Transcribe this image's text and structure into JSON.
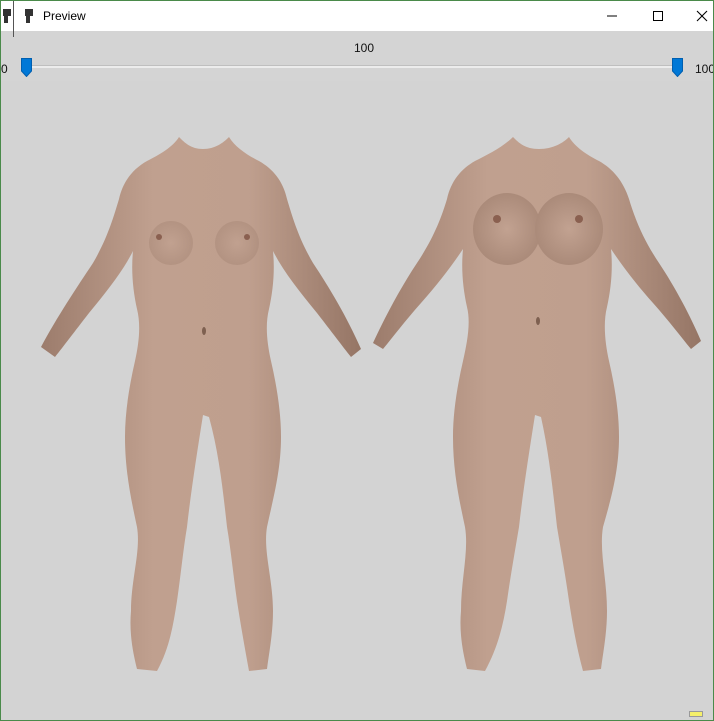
{
  "window": {
    "title": "Preview"
  },
  "slider": {
    "value_label": "100",
    "min_label": "0",
    "max_label": "100",
    "low_value": 0,
    "high_value": 100,
    "accent_color": "#0078d7"
  },
  "icons": {
    "app": "app-icon",
    "minimize": "minimize-icon",
    "maximize": "maximize-icon",
    "close": "close-icon"
  },
  "preview": {
    "models": [
      "base-body-model",
      "morphed-body-model"
    ],
    "skin_color": "#b59582",
    "background_color": "#d3d3d3"
  }
}
